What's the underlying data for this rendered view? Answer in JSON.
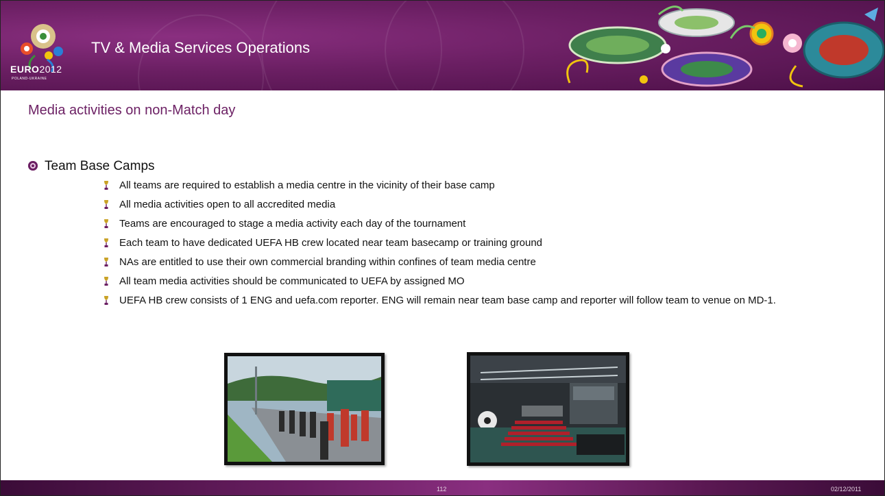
{
  "header": {
    "title": "TV & Media Services Operations",
    "logo_text_bold": "EURO",
    "logo_text_light": "2012",
    "logo_subtext": "POLAND-UKRAINE"
  },
  "slide": {
    "subtitle": "Media activities on non-Match day",
    "section_heading": "Team Base Camps",
    "bullets": [
      "All teams are required to establish a media centre in the vicinity of their base camp",
      "All media activities open to all accredited media",
      "Teams are encouraged to stage a media activity each day of the tournament",
      "Each team to have dedicated UEFA HB crew located near team basecamp or training ground",
      "NAs are entitled to use their own commercial branding within confines of team media centre",
      "All team media activities should be communicated to UEFA by assigned MO",
      "UEFA HB crew consists of 1 ENG and uefa.com reporter. ENG will remain near team base camp and reporter will follow team to venue on MD-1."
    ]
  },
  "footer": {
    "page_number": "112",
    "date": "02/12/2011"
  },
  "colors": {
    "brand_purple": "#6b1f63",
    "footer_text": "#e6d4e3"
  }
}
